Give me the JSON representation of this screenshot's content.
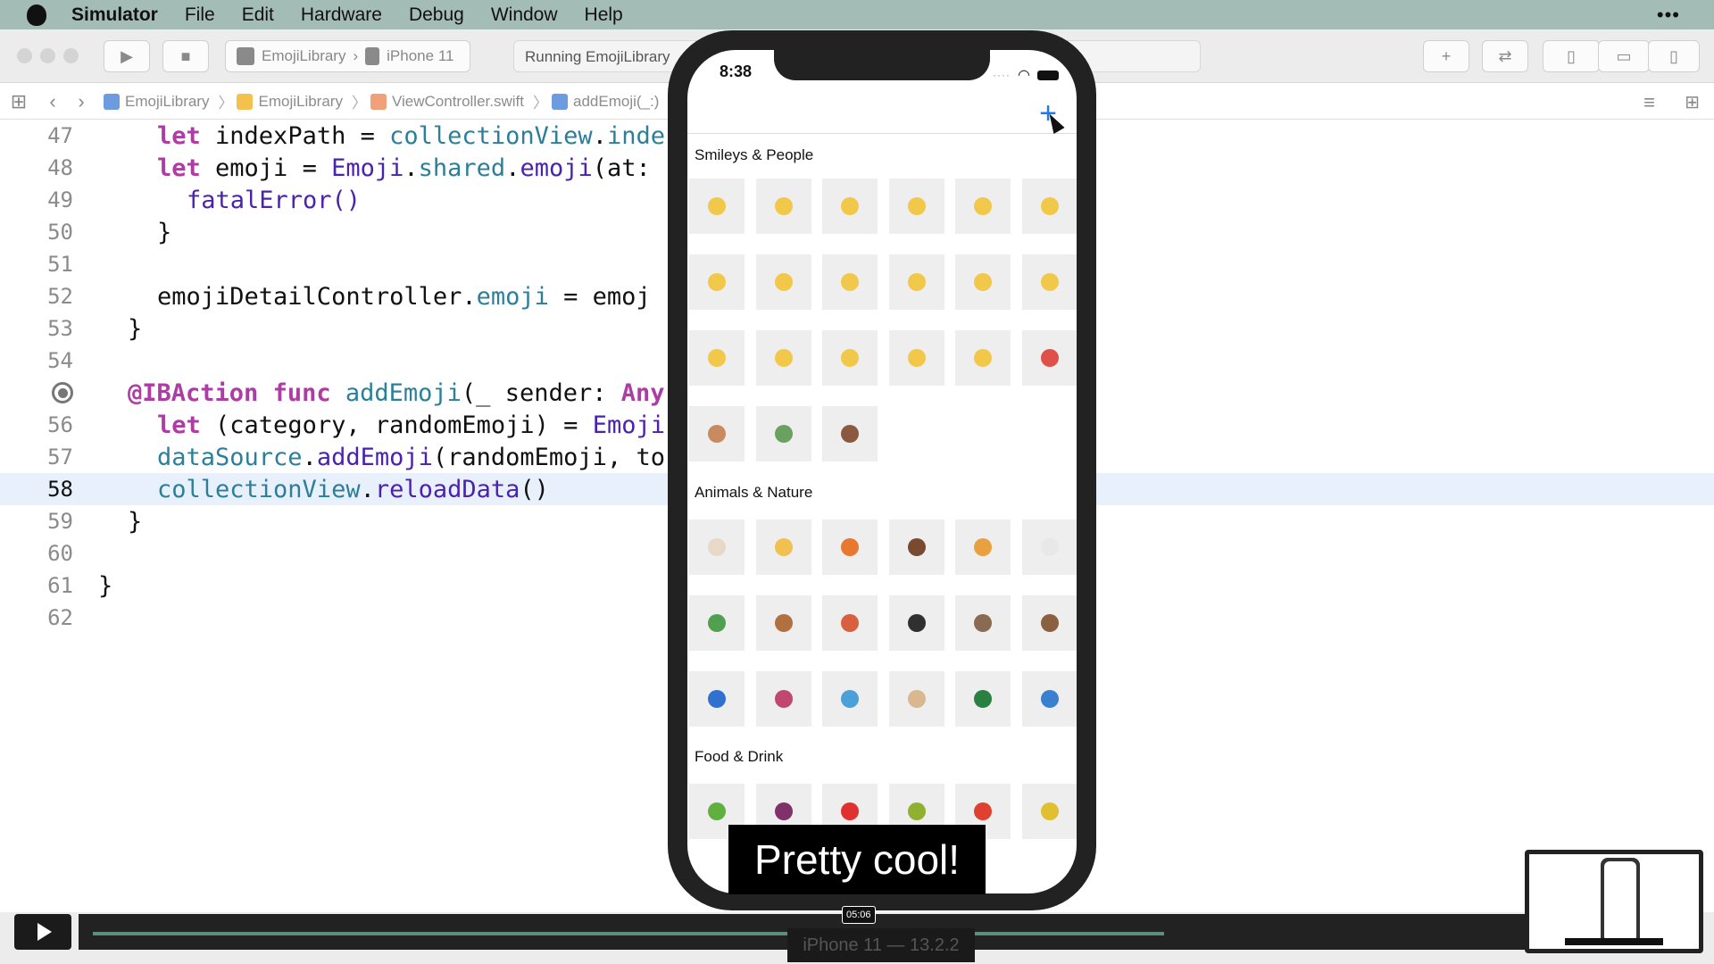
{
  "menubar": {
    "app": "Simulator",
    "items": [
      "File",
      "Edit",
      "Hardware",
      "Debug",
      "Window",
      "Help"
    ],
    "more": "•••"
  },
  "toolbar": {
    "scheme_target": "EmojiLibrary",
    "scheme_device": "iPhone 11",
    "status": "Running EmojiLibrary"
  },
  "jumpbar": {
    "crumbs": [
      "EmojiLibrary",
      "EmojiLibrary",
      "ViewController.swift",
      "addEmoji(_:)"
    ]
  },
  "editor": {
    "lines": [
      {
        "num": "47",
        "text": "let indexPath = collectionView.inde"
      },
      {
        "num": "48",
        "text": "let emoji = Emoji.shared.emoji(at:"
      },
      {
        "num": "49",
        "text": "fatalError()"
      },
      {
        "num": "50",
        "text": "}"
      },
      {
        "num": "51",
        "text": ""
      },
      {
        "num": "52",
        "text": "emojiDetailController.emoji = emoj"
      },
      {
        "num": "53",
        "text": "}"
      },
      {
        "num": "54",
        "text": ""
      },
      {
        "num": "55",
        "text": "@IBAction func addEmoji(_ sender: Any"
      },
      {
        "num": "56",
        "text": "let (category, randomEmoji) = Emoji"
      },
      {
        "num": "57",
        "text": "dataSource.addEmoji(randomEmoji, to"
      },
      {
        "num": "58",
        "text": "collectionView.reloadData()"
      },
      {
        "num": "59",
        "text": "}"
      },
      {
        "num": "60",
        "text": ""
      },
      {
        "num": "61",
        "text": "}"
      },
      {
        "num": "62",
        "text": ""
      }
    ],
    "current_line": "58"
  },
  "phone": {
    "time": "8:38",
    "sections": [
      {
        "title": "Smileys & People",
        "emoji_colors": [
          "#f2c84b",
          "#f2c84b",
          "#f2c84b",
          "#f2c84b",
          "#f2c84b",
          "#f2c84b",
          "#f2c84b",
          "#f2c84b",
          "#f2c84b",
          "#f2c84b",
          "#f2c84b",
          "#f2c84b",
          "#f2c84b",
          "#f2c84b",
          "#f2c84b",
          "#f2c84b",
          "#f2c84b",
          "#e0504a",
          "#c98a60",
          "#6aa060",
          "#8a5a40"
        ]
      },
      {
        "title": "Animals & Nature",
        "emoji_colors": [
          "#e8d8c8",
          "#f0c050",
          "#e87830",
          "#7a4a30",
          "#e8a040",
          "#e8e8e8",
          "#50a050",
          "#b07040",
          "#d86040",
          "#303030",
          "#8a6a50",
          "#8a6040",
          "#3070d0",
          "#c04870",
          "#4aa0d8",
          "#d8b890",
          "#2a8040",
          "#3a80d0"
        ]
      },
      {
        "title": "Food & Drink",
        "emoji_colors": [
          "#60b040",
          "#80306a",
          "#e03030",
          "#90b030",
          "#e04030",
          "#e0c030"
        ]
      }
    ]
  },
  "caption": "Pretty cool!",
  "player": {
    "timestamp": "05:06",
    "device_label": "iPhone 11 — 13.2.2"
  }
}
